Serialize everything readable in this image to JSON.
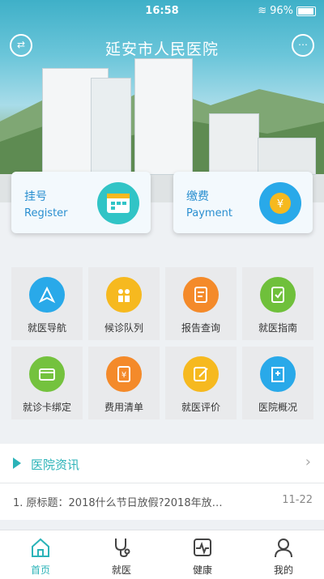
{
  "status_bar": {
    "time": "16:58",
    "battery": "96%"
  },
  "header": {
    "title": "延安市人民医院"
  },
  "cards": [
    {
      "cn": "挂号",
      "en": "Register"
    },
    {
      "cn": "缴费",
      "en": "Payment"
    }
  ],
  "grid": [
    {
      "label": "就医导航",
      "color": "#29a9e9",
      "icon": "navigation-icon"
    },
    {
      "label": "候诊队列",
      "color": "#f6b91f",
      "icon": "queue-icon"
    },
    {
      "label": "报告查询",
      "color": "#f48a2a",
      "icon": "report-icon"
    },
    {
      "label": "就医指南",
      "color": "#6fc03b",
      "icon": "guide-icon"
    },
    {
      "label": "就诊卡绑定",
      "color": "#74c23e",
      "icon": "card-bind-icon"
    },
    {
      "label": "费用清单",
      "color": "#f48a2a",
      "icon": "bill-icon"
    },
    {
      "label": "就医评价",
      "color": "#f6b91f",
      "icon": "rating-icon"
    },
    {
      "label": "医院概况",
      "color": "#29a9e9",
      "icon": "hospital-icon"
    }
  ],
  "news": {
    "section_title": "医院资讯",
    "items": [
      {
        "title": "1. 原标题：2018什么节日放假?2018年放…",
        "date": "11-22"
      }
    ]
  },
  "tabbar": [
    {
      "label": "首页",
      "icon": "home-icon"
    },
    {
      "label": "就医",
      "icon": "stethoscope-icon"
    },
    {
      "label": "健康",
      "icon": "health-icon"
    },
    {
      "label": "我的",
      "icon": "profile-icon"
    }
  ],
  "colors": {
    "accent": "#2bb3b8",
    "card_text": "#2a8fd0"
  }
}
